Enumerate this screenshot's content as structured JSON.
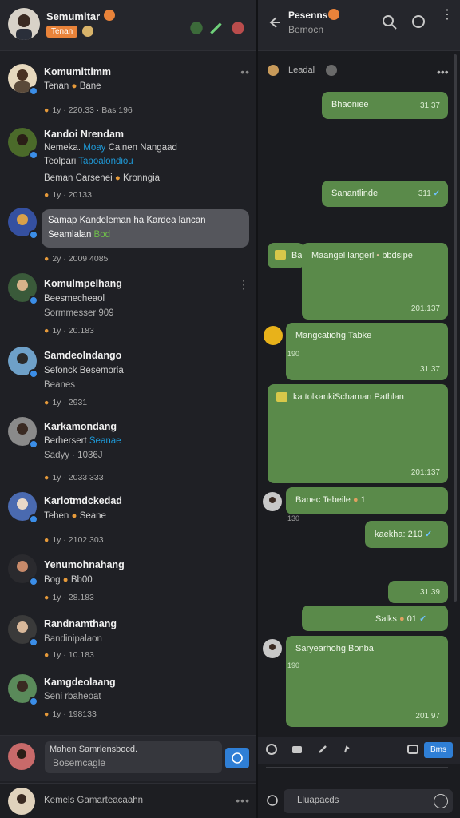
{
  "left_header": {
    "title": "Semumitar",
    "subtitle": "Tenan"
  },
  "threads": [
    {
      "name": "Komumittimm",
      "line1": "Tenan",
      "line1b": "Bane",
      "meta": "1y · 220.33",
      "meta2": "Bas 196"
    },
    {
      "name": "Kandoi Nrendam",
      "line1": "Nemeka.",
      "line1_blue": "Moay",
      "line1_rest": "Cainen Nangaad",
      "line2": "Teolpari",
      "line2_blue": "Tapoalondiou",
      "line3": "Beman Carsenei",
      "line3b": "Kronngia",
      "meta": "1y · 20133"
    },
    {
      "name": "",
      "bubble": "Samap Kandeleman ha Kardea lancan",
      "bubble2": "Seamlalan",
      "bubble2_green": "Bod",
      "meta": "2y · 2009 4085"
    },
    {
      "name": "Komulmpelhang",
      "line1": "Beesmecheaol",
      "line2": "Sormmesser 909",
      "meta": "1y · 20.183"
    },
    {
      "name": "Samdeolndango",
      "line1": "Sefonck Besemoria",
      "line2": "Beanes",
      "meta": "1y · 2931"
    },
    {
      "name": "Karkamondang",
      "line1": "Berhersert",
      "line1_blue": "Seanae",
      "line2": "Sadyy · 1036J",
      "meta": "1y · 2033 333"
    },
    {
      "name": "Karlotmdckedad",
      "line1": "Tehen",
      "line1b": "Seane",
      "meta": "1y · 2102 303"
    },
    {
      "name": "Yenumohnahang",
      "line1": "Bog",
      "line1b": "Bb00",
      "meta": "1y · 28.183"
    },
    {
      "name": "Randnamthang",
      "line1": "Bandinipalaon",
      "meta": "1y · 10.183"
    },
    {
      "name": "Kamgdeolaang",
      "line1": "Seni rbaheoat",
      "meta": "1y · 198133"
    }
  ],
  "composer": {
    "line1": "Mahen Samrlensbocd.",
    "placeholder": "Bosemcagle"
  },
  "footer_left": {
    "text": "Kemels Gamarteacaahn"
  },
  "right_header": {
    "title": "Pesenns",
    "subtitle": "Bemocn"
  },
  "chat_label": "Leadal",
  "messages": [
    {
      "text": "Bhaoniee",
      "time": "31:37"
    },
    {
      "text": "Sanantlinde",
      "time": "311"
    },
    {
      "text": "Maangel langerl",
      "text2": "bbdsipe",
      "time": "201.137",
      "side_label": "Ba"
    },
    {
      "text": "Mangcatiohg Tabke",
      "time": "31:37",
      "sub": "190"
    },
    {
      "text": "ka tolkankiSchaman Pathlan",
      "time": "201:137"
    },
    {
      "text": "Banec Tebeile",
      "sub": "130"
    },
    {
      "text": "kaekha:",
      "time": "210"
    },
    {
      "time": "31:39"
    },
    {
      "text": "Salks",
      "time": "01"
    },
    {
      "text": "Saryearhohg Bonba",
      "time": "201.97",
      "sub": "190"
    }
  ],
  "toolbar_button": "Bms",
  "input_placeholder": "Lluapacds"
}
